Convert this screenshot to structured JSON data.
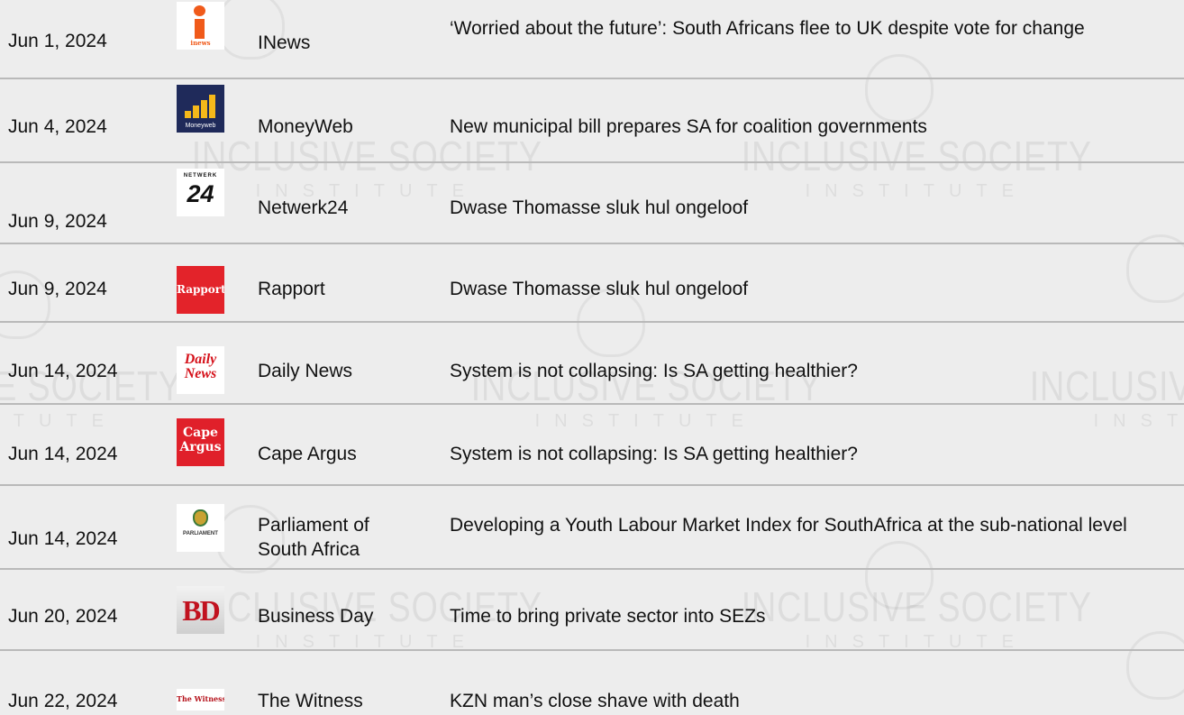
{
  "watermark": {
    "line1": "INCLUSIVE SOCIETY",
    "line2": "INSTITUTE"
  },
  "rows": [
    {
      "date": "Jun 1, 2024",
      "source": "INews",
      "logo": "inews",
      "logo_text": "inews",
      "headline": "‘Worried about the future’: South Africans flee to UK despite vote for change"
    },
    {
      "date": "Jun 4, 2024",
      "source": "MoneyWeb",
      "logo": "moneyweb",
      "logo_text": "Moneyweb",
      "headline": "New municipal bill prepares SA for coalition governments"
    },
    {
      "date": "Jun 9, 2024",
      "source": "Netwerk24",
      "logo": "netwerk24",
      "logo_text": "NETWERK",
      "logo_text2": "24",
      "headline": "Dwase Thomasse sluk hul ongeloof"
    },
    {
      "date": "Jun 9, 2024",
      "source": "Rapport",
      "logo": "rapport",
      "logo_text": "Rapport",
      "headline": "Dwase Thomasse sluk hul ongeloof"
    },
    {
      "date": "Jun 14, 2024",
      "source": "Daily News",
      "logo": "daily-news",
      "logo_text": "Daily News",
      "headline": "System is not collapsing: Is SA getting healthier?"
    },
    {
      "date": "Jun 14, 2024",
      "source": "Cape Argus",
      "logo": "cape-argus",
      "logo_text": "Cape Argus",
      "headline": "System is not collapsing: Is SA getting healthier?"
    },
    {
      "date": "Jun 14, 2024",
      "source": "Parliament of South Africa",
      "logo": "parliament",
      "logo_text": "PARLIAMENT",
      "headline": "Developing a Youth Labour Market Index for SouthAfrica at the sub-national level"
    },
    {
      "date": "Jun 20, 2024",
      "source": "Business Day",
      "logo": "business-day",
      "logo_text": "BD",
      "headline": "Time to bring private sector into SEZs"
    },
    {
      "date": "Jun 22, 2024",
      "source": "The Witness",
      "logo": "the-witness",
      "logo_text": "The Witness",
      "headline": "KZN man’s close shave with death"
    }
  ]
}
